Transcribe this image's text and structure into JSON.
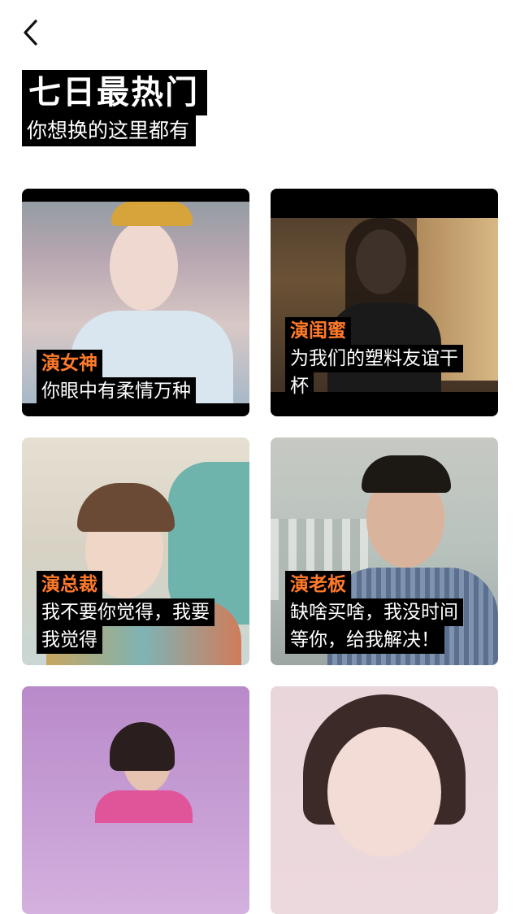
{
  "header": {
    "back_icon": "chevron-left-icon",
    "title": "七日最热门",
    "subtitle": "你想换的这里都有"
  },
  "cards": [
    {
      "role": "演女神",
      "line1": "你眼中有柔情万种",
      "line2": ""
    },
    {
      "role": "演闺蜜",
      "line1": "为我们的塑料友谊干",
      "line2": "杯"
    },
    {
      "role": "演总裁",
      "line1": "我不要你觉得，我要",
      "line2": "我觉得"
    },
    {
      "role": "演老板",
      "line1": "缺啥买啥，我没时间",
      "line2": "等你，给我解决！"
    },
    {
      "role": "",
      "line1": "",
      "line2": ""
    },
    {
      "role": "",
      "line1": "",
      "line2": ""
    }
  ],
  "colors": {
    "accent": "#ff7a2a",
    "caption_bg": "#000000"
  }
}
